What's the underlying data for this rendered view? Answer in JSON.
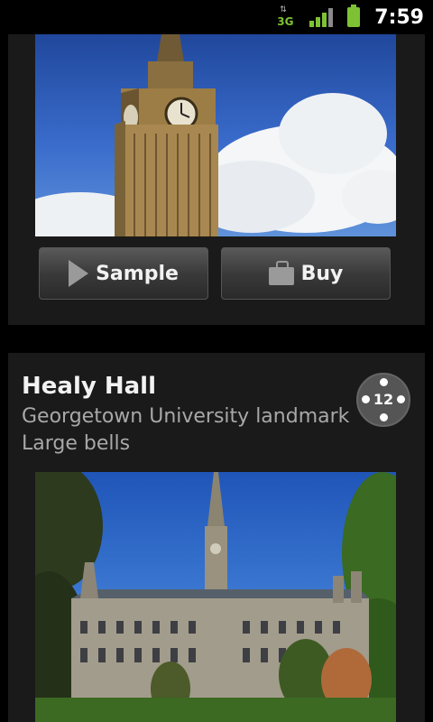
{
  "status_bar": {
    "network_type": "3G",
    "time": "7:59",
    "colors": {
      "accent": "#7ec234"
    }
  },
  "card1": {
    "photo": {
      "icon": "big-ben-photo"
    },
    "sample_button": {
      "label": "Sample",
      "icon": "play-icon"
    },
    "buy_button": {
      "label": "Buy",
      "icon": "shopping-bag-icon"
    }
  },
  "card2": {
    "title": "Healy Hall",
    "subtitle_line1": "Georgetown University landmark",
    "subtitle_line2": "Large bells",
    "badge_count": "12",
    "photo": {
      "icon": "healy-hall-photo"
    }
  }
}
